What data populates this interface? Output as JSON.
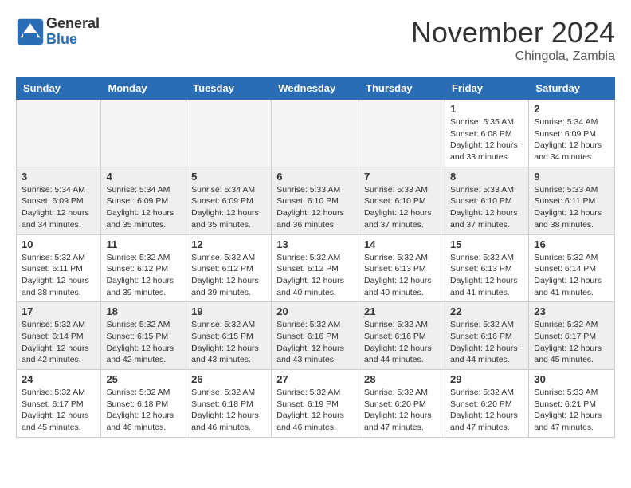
{
  "logo": {
    "general": "General",
    "blue": "Blue"
  },
  "title": "November 2024",
  "location": "Chingola, Zambia",
  "weekdays": [
    "Sunday",
    "Monday",
    "Tuesday",
    "Wednesday",
    "Thursday",
    "Friday",
    "Saturday"
  ],
  "weeks": [
    [
      {
        "day": "",
        "info": ""
      },
      {
        "day": "",
        "info": ""
      },
      {
        "day": "",
        "info": ""
      },
      {
        "day": "",
        "info": ""
      },
      {
        "day": "",
        "info": ""
      },
      {
        "day": "1",
        "info": "Sunrise: 5:35 AM\nSunset: 6:08 PM\nDaylight: 12 hours\nand 33 minutes."
      },
      {
        "day": "2",
        "info": "Sunrise: 5:34 AM\nSunset: 6:09 PM\nDaylight: 12 hours\nand 34 minutes."
      }
    ],
    [
      {
        "day": "3",
        "info": "Sunrise: 5:34 AM\nSunset: 6:09 PM\nDaylight: 12 hours\nand 34 minutes."
      },
      {
        "day": "4",
        "info": "Sunrise: 5:34 AM\nSunset: 6:09 PM\nDaylight: 12 hours\nand 35 minutes."
      },
      {
        "day": "5",
        "info": "Sunrise: 5:34 AM\nSunset: 6:09 PM\nDaylight: 12 hours\nand 35 minutes."
      },
      {
        "day": "6",
        "info": "Sunrise: 5:33 AM\nSunset: 6:10 PM\nDaylight: 12 hours\nand 36 minutes."
      },
      {
        "day": "7",
        "info": "Sunrise: 5:33 AM\nSunset: 6:10 PM\nDaylight: 12 hours\nand 37 minutes."
      },
      {
        "day": "8",
        "info": "Sunrise: 5:33 AM\nSunset: 6:10 PM\nDaylight: 12 hours\nand 37 minutes."
      },
      {
        "day": "9",
        "info": "Sunrise: 5:33 AM\nSunset: 6:11 PM\nDaylight: 12 hours\nand 38 minutes."
      }
    ],
    [
      {
        "day": "10",
        "info": "Sunrise: 5:32 AM\nSunset: 6:11 PM\nDaylight: 12 hours\nand 38 minutes."
      },
      {
        "day": "11",
        "info": "Sunrise: 5:32 AM\nSunset: 6:12 PM\nDaylight: 12 hours\nand 39 minutes."
      },
      {
        "day": "12",
        "info": "Sunrise: 5:32 AM\nSunset: 6:12 PM\nDaylight: 12 hours\nand 39 minutes."
      },
      {
        "day": "13",
        "info": "Sunrise: 5:32 AM\nSunset: 6:12 PM\nDaylight: 12 hours\nand 40 minutes."
      },
      {
        "day": "14",
        "info": "Sunrise: 5:32 AM\nSunset: 6:13 PM\nDaylight: 12 hours\nand 40 minutes."
      },
      {
        "day": "15",
        "info": "Sunrise: 5:32 AM\nSunset: 6:13 PM\nDaylight: 12 hours\nand 41 minutes."
      },
      {
        "day": "16",
        "info": "Sunrise: 5:32 AM\nSunset: 6:14 PM\nDaylight: 12 hours\nand 41 minutes."
      }
    ],
    [
      {
        "day": "17",
        "info": "Sunrise: 5:32 AM\nSunset: 6:14 PM\nDaylight: 12 hours\nand 42 minutes."
      },
      {
        "day": "18",
        "info": "Sunrise: 5:32 AM\nSunset: 6:15 PM\nDaylight: 12 hours\nand 42 minutes."
      },
      {
        "day": "19",
        "info": "Sunrise: 5:32 AM\nSunset: 6:15 PM\nDaylight: 12 hours\nand 43 minutes."
      },
      {
        "day": "20",
        "info": "Sunrise: 5:32 AM\nSunset: 6:16 PM\nDaylight: 12 hours\nand 43 minutes."
      },
      {
        "day": "21",
        "info": "Sunrise: 5:32 AM\nSunset: 6:16 PM\nDaylight: 12 hours\nand 44 minutes."
      },
      {
        "day": "22",
        "info": "Sunrise: 5:32 AM\nSunset: 6:16 PM\nDaylight: 12 hours\nand 44 minutes."
      },
      {
        "day": "23",
        "info": "Sunrise: 5:32 AM\nSunset: 6:17 PM\nDaylight: 12 hours\nand 45 minutes."
      }
    ],
    [
      {
        "day": "24",
        "info": "Sunrise: 5:32 AM\nSunset: 6:17 PM\nDaylight: 12 hours\nand 45 minutes."
      },
      {
        "day": "25",
        "info": "Sunrise: 5:32 AM\nSunset: 6:18 PM\nDaylight: 12 hours\nand 46 minutes."
      },
      {
        "day": "26",
        "info": "Sunrise: 5:32 AM\nSunset: 6:18 PM\nDaylight: 12 hours\nand 46 minutes."
      },
      {
        "day": "27",
        "info": "Sunrise: 5:32 AM\nSunset: 6:19 PM\nDaylight: 12 hours\nand 46 minutes."
      },
      {
        "day": "28",
        "info": "Sunrise: 5:32 AM\nSunset: 6:20 PM\nDaylight: 12 hours\nand 47 minutes."
      },
      {
        "day": "29",
        "info": "Sunrise: 5:32 AM\nSunset: 6:20 PM\nDaylight: 12 hours\nand 47 minutes."
      },
      {
        "day": "30",
        "info": "Sunrise: 5:33 AM\nSunset: 6:21 PM\nDaylight: 12 hours\nand 47 minutes."
      }
    ]
  ]
}
